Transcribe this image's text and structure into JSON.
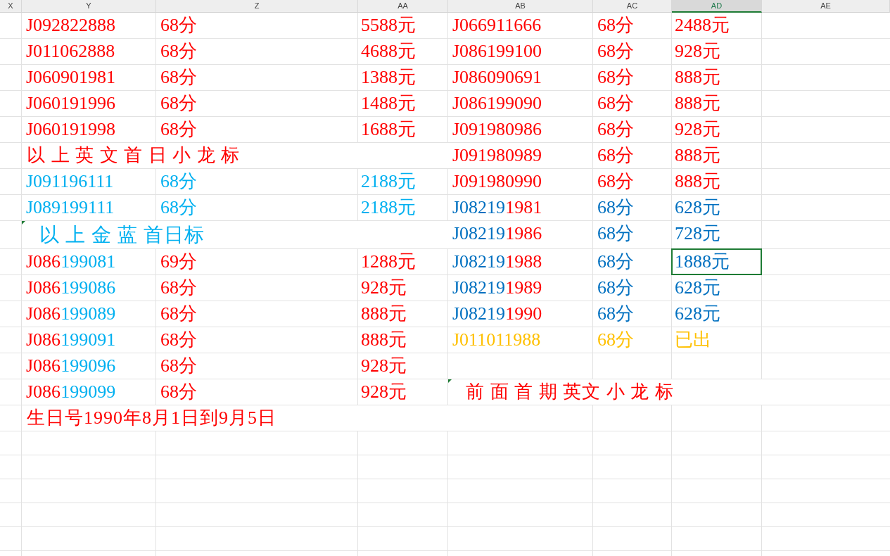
{
  "columns": [
    {
      "label": "X",
      "selected": false
    },
    {
      "label": "Y",
      "selected": false
    },
    {
      "label": "Z",
      "selected": false
    },
    {
      "label": "AA",
      "selected": false
    },
    {
      "label": "AB",
      "selected": false
    },
    {
      "label": "AC",
      "selected": false
    },
    {
      "label": "AD",
      "selected": true
    },
    {
      "label": "AE",
      "selected": false
    }
  ],
  "rows": [
    {
      "left": {
        "kind": "entry",
        "number": [
          {
            "text": "J092822888",
            "color": "#ff0000"
          }
        ],
        "score": {
          "text": "68分",
          "color": "#ff0000"
        },
        "price": {
          "text": "5588元",
          "color": "#ff0000"
        },
        "selected": false
      },
      "right": {
        "kind": "entry",
        "number": [
          {
            "text": "J066911666",
            "color": "#ff0000"
          }
        ],
        "score": {
          "text": "68分",
          "color": "#ff0000"
        },
        "price": {
          "text": "2488元",
          "color": "#ff0000"
        },
        "selected": false
      }
    },
    {
      "left": {
        "kind": "entry",
        "number": [
          {
            "text": "J011062888",
            "color": "#ff0000"
          }
        ],
        "score": {
          "text": "68分",
          "color": "#ff0000"
        },
        "price": {
          "text": "4688元",
          "color": "#ff0000"
        },
        "selected": false
      },
      "right": {
        "kind": "entry",
        "number": [
          {
            "text": "J086199100",
            "color": "#ff0000"
          }
        ],
        "score": {
          "text": "68分",
          "color": "#ff0000"
        },
        "price": {
          "text": "928元",
          "color": "#ff0000"
        },
        "selected": false
      }
    },
    {
      "left": {
        "kind": "entry",
        "number": [
          {
            "text": "J060901981",
            "color": "#ff0000"
          }
        ],
        "score": {
          "text": "68分",
          "color": "#ff0000"
        },
        "price": {
          "text": "1388元",
          "color": "#ff0000"
        },
        "selected": false
      },
      "right": {
        "kind": "entry",
        "number": [
          {
            "text": "J086090691",
            "color": "#ff0000"
          }
        ],
        "score": {
          "text": "68分",
          "color": "#ff0000"
        },
        "price": {
          "text": "888元",
          "color": "#ff0000"
        },
        "selected": false
      }
    },
    {
      "left": {
        "kind": "entry",
        "number": [
          {
            "text": "J060191996",
            "color": "#ff0000"
          }
        ],
        "score": {
          "text": "68分",
          "color": "#ff0000"
        },
        "price": {
          "text": "1488元",
          "color": "#ff0000"
        },
        "selected": false
      },
      "right": {
        "kind": "entry",
        "number": [
          {
            "text": "J086199090",
            "color": "#ff0000"
          }
        ],
        "score": {
          "text": "68分",
          "color": "#ff0000"
        },
        "price": {
          "text": "888元",
          "color": "#ff0000"
        },
        "selected": false
      }
    },
    {
      "left": {
        "kind": "entry",
        "number": [
          {
            "text": "J060191998",
            "color": "#ff0000"
          }
        ],
        "score": {
          "text": "68分",
          "color": "#ff0000"
        },
        "price": {
          "text": "1688元",
          "color": "#ff0000"
        },
        "selected": false
      },
      "right": {
        "kind": "entry",
        "number": [
          {
            "text": "J091980986",
            "color": "#ff0000"
          }
        ],
        "score": {
          "text": "68分",
          "color": "#ff0000"
        },
        "price": {
          "text": "928元",
          "color": "#ff0000"
        },
        "selected": false
      }
    },
    {
      "left": {
        "kind": "note",
        "text": "以 上 英 文 首 日 小 龙 标",
        "color": "#ff0000",
        "comment": false
      },
      "right": {
        "kind": "entry",
        "number": [
          {
            "text": "J091980989",
            "color": "#ff0000"
          }
        ],
        "score": {
          "text": "68分",
          "color": "#ff0000"
        },
        "price": {
          "text": "888元",
          "color": "#ff0000"
        },
        "selected": false
      }
    },
    {
      "left": {
        "kind": "entry",
        "number": [
          {
            "text": "J091196111",
            "color": "#00b0f0"
          }
        ],
        "score": {
          "text": "68分",
          "color": "#00b0f0"
        },
        "price": {
          "text": "2188元",
          "color": "#00b0f0"
        },
        "selected": false
      },
      "right": {
        "kind": "entry",
        "number": [
          {
            "text": "J091980990",
            "color": "#ff0000"
          }
        ],
        "score": {
          "text": "68分",
          "color": "#ff0000"
        },
        "price": {
          "text": "888元",
          "color": "#ff0000"
        },
        "selected": false
      }
    },
    {
      "left": {
        "kind": "entry",
        "number": [
          {
            "text": "J089199111",
            "color": "#00b0f0"
          }
        ],
        "score": {
          "text": "68分",
          "color": "#00b0f0"
        },
        "price": {
          "text": "2188元",
          "color": "#00b0f0"
        },
        "selected": false
      },
      "right": {
        "kind": "entry",
        "number": [
          {
            "text": "J08219",
            "color": "#0070c0"
          },
          {
            "text": "1981",
            "color": "#ff0000"
          }
        ],
        "score": {
          "text": "68分",
          "color": "#0070c0"
        },
        "price": {
          "text": "628元",
          "color": "#0070c0"
        },
        "selected": false
      }
    },
    {
      "left": {
        "kind": "note",
        "text": "以 上 金 蓝 首日标",
        "color": "#00b0f0",
        "comment": true
      },
      "right": {
        "kind": "entry",
        "number": [
          {
            "text": "J08219",
            "color": "#0070c0"
          },
          {
            "text": "1986",
            "color": "#ff0000"
          }
        ],
        "score": {
          "text": "68分",
          "color": "#0070c0"
        },
        "price": {
          "text": "728元",
          "color": "#0070c0"
        },
        "selected": false
      }
    },
    {
      "left": {
        "kind": "entry",
        "number": [
          {
            "text": "J086",
            "color": "#ff0000"
          },
          {
            "text": "199081",
            "color": "#00b0f0"
          }
        ],
        "score": {
          "text": "69分",
          "color": "#ff0000"
        },
        "price": {
          "text": "1288元",
          "color": "#ff0000"
        },
        "selected": false
      },
      "right": {
        "kind": "entry",
        "number": [
          {
            "text": "J08219",
            "color": "#0070c0"
          },
          {
            "text": "1988",
            "color": "#ff0000"
          }
        ],
        "score": {
          "text": "68分",
          "color": "#0070c0"
        },
        "price": {
          "text": "1888元",
          "color": "#0070c0"
        },
        "selected": true
      }
    },
    {
      "left": {
        "kind": "entry",
        "number": [
          {
            "text": "J086",
            "color": "#ff0000"
          },
          {
            "text": "199086",
            "color": "#00b0f0"
          }
        ],
        "score": {
          "text": "68分",
          "color": "#ff0000"
        },
        "price": {
          "text": "928元",
          "color": "#ff0000"
        },
        "selected": false
      },
      "right": {
        "kind": "entry",
        "number": [
          {
            "text": "J08219",
            "color": "#0070c0"
          },
          {
            "text": "1989",
            "color": "#ff0000"
          }
        ],
        "score": {
          "text": "68分",
          "color": "#0070c0"
        },
        "price": {
          "text": "628元",
          "color": "#0070c0"
        },
        "selected": false
      }
    },
    {
      "left": {
        "kind": "entry",
        "number": [
          {
            "text": "J086",
            "color": "#ff0000"
          },
          {
            "text": "199089",
            "color": "#00b0f0"
          }
        ],
        "score": {
          "text": "68分",
          "color": "#ff0000"
        },
        "price": {
          "text": "888元",
          "color": "#ff0000"
        },
        "selected": false
      },
      "right": {
        "kind": "entry",
        "number": [
          {
            "text": "J08219",
            "color": "#0070c0"
          },
          {
            "text": "1990",
            "color": "#ff0000"
          }
        ],
        "score": {
          "text": "68分",
          "color": "#0070c0"
        },
        "price": {
          "text": "628元",
          "color": "#0070c0"
        },
        "selected": false
      }
    },
    {
      "left": {
        "kind": "entry",
        "number": [
          {
            "text": "J086",
            "color": "#ff0000"
          },
          {
            "text": "199091",
            "color": "#00b0f0"
          }
        ],
        "score": {
          "text": "68分",
          "color": "#ff0000"
        },
        "price": {
          "text": "888元",
          "color": "#ff0000"
        },
        "selected": false
      },
      "right": {
        "kind": "entry",
        "number": [
          {
            "text": "J011011988",
            "color": "#ffc000"
          }
        ],
        "score": {
          "text": "68分",
          "color": "#ffc000"
        },
        "price": {
          "text": "已出",
          "color": "#ffc000"
        },
        "selected": false
      }
    },
    {
      "left": {
        "kind": "entry",
        "number": [
          {
            "text": "J086",
            "color": "#ff0000"
          },
          {
            "text": "199096",
            "color": "#00b0f0"
          }
        ],
        "score": {
          "text": "68分",
          "color": "#ff0000"
        },
        "price": {
          "text": "928元",
          "color": "#ff0000"
        },
        "selected": false
      },
      "right": {
        "kind": "empty"
      }
    },
    {
      "left": {
        "kind": "entry",
        "number": [
          {
            "text": "J086",
            "color": "#ff0000"
          },
          {
            "text": "199099",
            "color": "#00b0f0"
          }
        ],
        "score": {
          "text": "68分",
          "color": "#ff0000"
        },
        "price": {
          "text": "928元",
          "color": "#ff0000"
        },
        "selected": false
      },
      "right": {
        "kind": "note",
        "text": "前 面 首 期 英文 小 龙 标",
        "color": "#ff0000",
        "comment": true
      }
    },
    {
      "left": {
        "kind": "note",
        "text": "生日号1990年8月1日到9月5日",
        "color": "#ff0000",
        "comment": false
      },
      "right": {
        "kind": "empty"
      }
    }
  ]
}
